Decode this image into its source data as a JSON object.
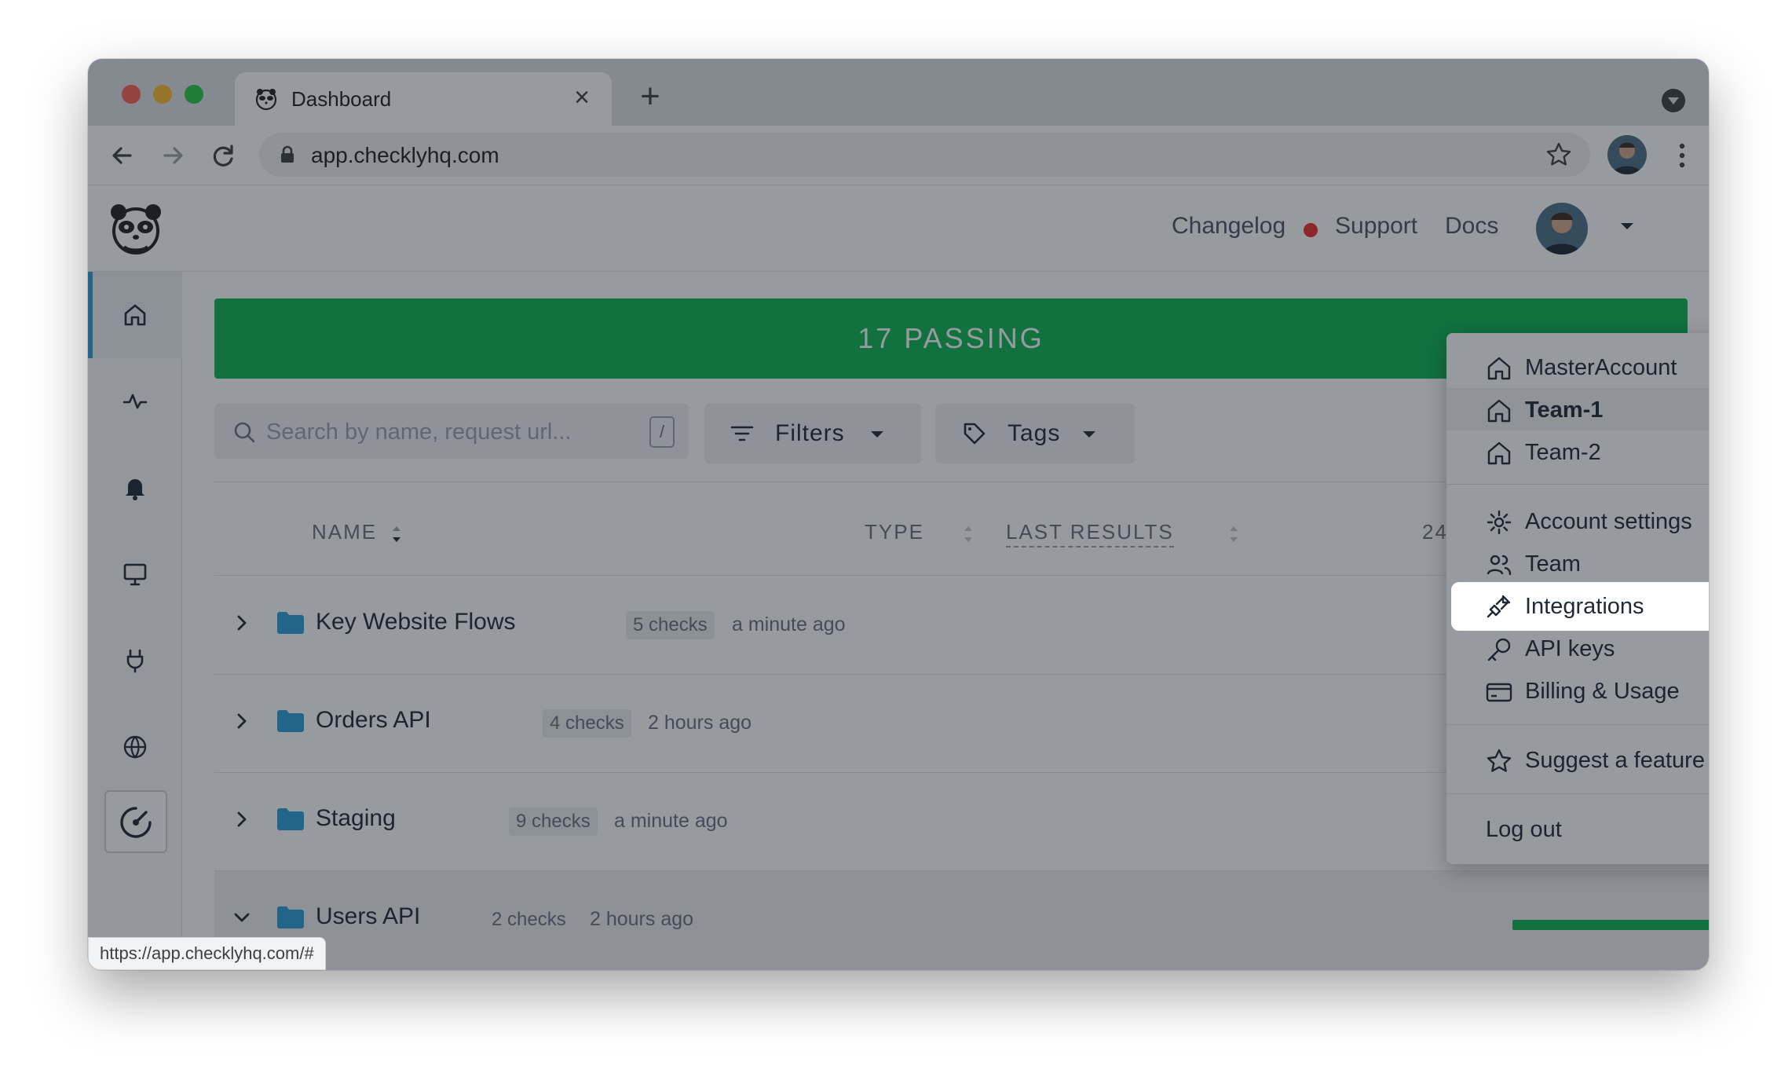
{
  "browser": {
    "tab_title": "Dashboard",
    "tab_close": "×",
    "new_tab": "+",
    "url": "app.checklyhq.com",
    "status_url": "https://app.checklyhq.com/#"
  },
  "topnav": {
    "changelog": "Changelog",
    "support": "Support",
    "docs": "Docs"
  },
  "banner": {
    "text": "17 PASSING",
    "color": "#0bb553"
  },
  "search": {
    "placeholder": "Search by name, request url...",
    "shortcut": "/"
  },
  "filters": {
    "filters_label": "Filters",
    "tags_label": "Tags"
  },
  "table": {
    "headers": {
      "name": "NAME",
      "type": "TYPE",
      "last_results": "LAST RESULTS",
      "h24": "24I"
    },
    "rows": [
      {
        "name": "Key Website Flows",
        "checks": "5 checks",
        "time": "a minute ago",
        "expanded": false
      },
      {
        "name": "Orders API",
        "checks": "4 checks",
        "time": "2 hours ago",
        "expanded": false
      },
      {
        "name": "Staging",
        "checks": "9 checks",
        "time": "a minute ago",
        "expanded": false
      },
      {
        "name": "Users API",
        "checks": "2 checks",
        "time": "2 hours ago",
        "expanded": true
      }
    ]
  },
  "account_menu": {
    "accounts": [
      {
        "label": "MasterAccount",
        "icon": "home-icon",
        "bold": false
      },
      {
        "label": "Team-1",
        "icon": "home-icon",
        "bold": true
      },
      {
        "label": "Team-2",
        "icon": "home-icon",
        "bold": false
      }
    ],
    "settings_items": [
      {
        "label": "Account settings",
        "icon": "gear-icon"
      },
      {
        "label": "Team",
        "icon": "users-icon"
      },
      {
        "label": "Integrations",
        "icon": "plug-icon",
        "highlighted": true
      },
      {
        "label": "API keys",
        "icon": "key-icon"
      },
      {
        "label": "Billing & Usage",
        "icon": "credit-card-icon"
      }
    ],
    "suggest": "Suggest a feature",
    "logout": "Log out"
  },
  "colors": {
    "accent_blue": "#2b9fd8",
    "passing_green": "#0bb553",
    "alert_red": "#ef2b2b"
  }
}
